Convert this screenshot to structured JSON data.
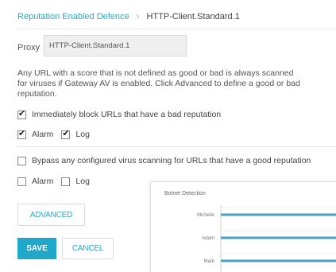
{
  "breadcrumb": {
    "parent": "Reputation Enabled Defence",
    "separator": "›",
    "current": "HTTP-Client.Standard.1"
  },
  "proxy": {
    "label": "Proxy",
    "value": "HTTP-Client.Standard.1"
  },
  "description": {
    "line1": "Any URL with a score that is not defined as good or bad is always scanned",
    "line2": "for viruses if Gateway AV is enabled. Click Advanced to define a good or bad",
    "line3": "reputation."
  },
  "block_bad": {
    "label": "Immediately block URLs that have a bad reputation",
    "checked": true,
    "alarm_label": "Alarm",
    "alarm_checked": true,
    "log_label": "Log",
    "log_checked": true
  },
  "bypass_good": {
    "label": "Bypass any configured virus scanning for URLs that have a good reputation",
    "checked": false,
    "alarm_label": "Alarm",
    "alarm_checked": false,
    "log_label": "Log",
    "log_checked": false
  },
  "buttons": {
    "advanced": "ADVANCED",
    "save": "SAVE",
    "cancel": "CANCEL"
  },
  "colors": {
    "accent": "#1fa8c9",
    "link": "#2aa7c7",
    "bar": "#4a9fc6"
  },
  "chart_data": {
    "type": "bar",
    "orientation": "horizontal",
    "title": "Botnet Detection",
    "categories": [
      "Michelle",
      "Adam",
      "Mark"
    ],
    "values": [
      100,
      100,
      100
    ],
    "xlim": [
      0,
      100
    ],
    "grid": true
  }
}
